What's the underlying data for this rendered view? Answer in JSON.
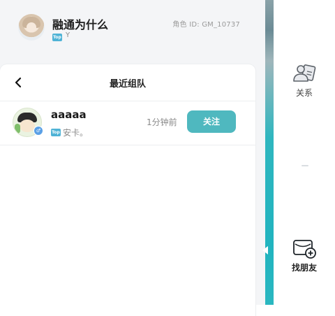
{
  "profile": {
    "name": "融通为什么",
    "tag": "Top",
    "sub": "Y",
    "role_id": "角色 ID: GM_10737"
  },
  "recent": {
    "title": "最近组队",
    "items": [
      {
        "name": "aaaaa",
        "tag": "Top",
        "sub": "安卡。",
        "time": "1分钟前",
        "follow_label": "关注"
      }
    ]
  },
  "sidebar": {
    "items": [
      {
        "label": "关系",
        "icon": "relationship-icon"
      },
      {
        "label": "找朋友",
        "icon": "find-friends-icon"
      }
    ]
  },
  "colors": {
    "accent": "#4fb8bf",
    "tag_blue": "#4fb3d6",
    "panel_bg": "#f4f5f7"
  }
}
